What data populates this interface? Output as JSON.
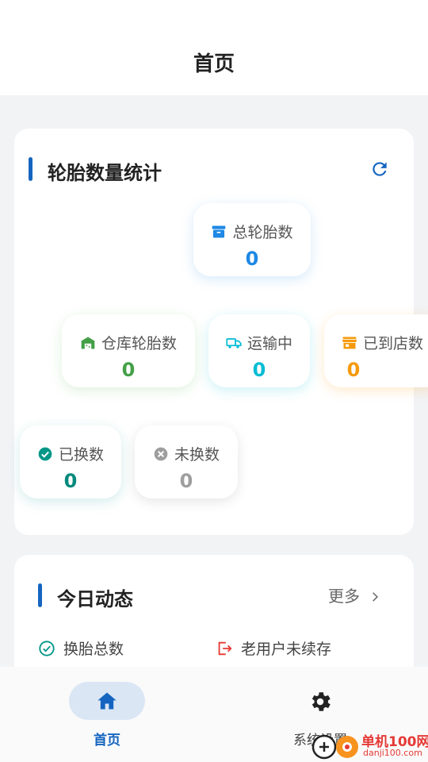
{
  "header": {
    "title": "首页"
  },
  "stats_card": {
    "title": "轮胎数量统计",
    "refresh_icon": "refresh-icon",
    "nodes": {
      "total": {
        "label": "总轮胎数",
        "value": "0",
        "icon": "archive-icon",
        "color": "#1e88e5"
      },
      "warehouse": {
        "label": "仓库轮胎数",
        "value": "0",
        "icon": "warehouse-icon",
        "color": "#43a047"
      },
      "transit": {
        "label": "运输中",
        "value": "0",
        "icon": "truck-icon",
        "color": "#00bcd4"
      },
      "store": {
        "label": "已到店数",
        "value": "0",
        "icon": "store-icon",
        "color": "#f59a0c"
      },
      "replaced": {
        "label": "已换数",
        "value": "0",
        "icon": "check-circle-icon",
        "color": "#009688"
      },
      "not_replaced": {
        "label": "未换数",
        "value": "0",
        "icon": "x-circle-icon",
        "color": "#9e9e9e"
      }
    }
  },
  "today_card": {
    "title": "今日动态",
    "more_label": "更多",
    "items": [
      {
        "label": "换胎总数",
        "icon": "check-circle-outline-icon"
      },
      {
        "label": "老用户未续存",
        "icon": "exit-icon"
      }
    ]
  },
  "tabbar": {
    "home_label": "首页",
    "settings_label": "系统设置"
  },
  "watermark": {
    "text": "单机100网",
    "url_text": "danji100.com"
  },
  "colors": {
    "accent": "#1565c0",
    "tab_active_bg": "#dbe6f5"
  }
}
